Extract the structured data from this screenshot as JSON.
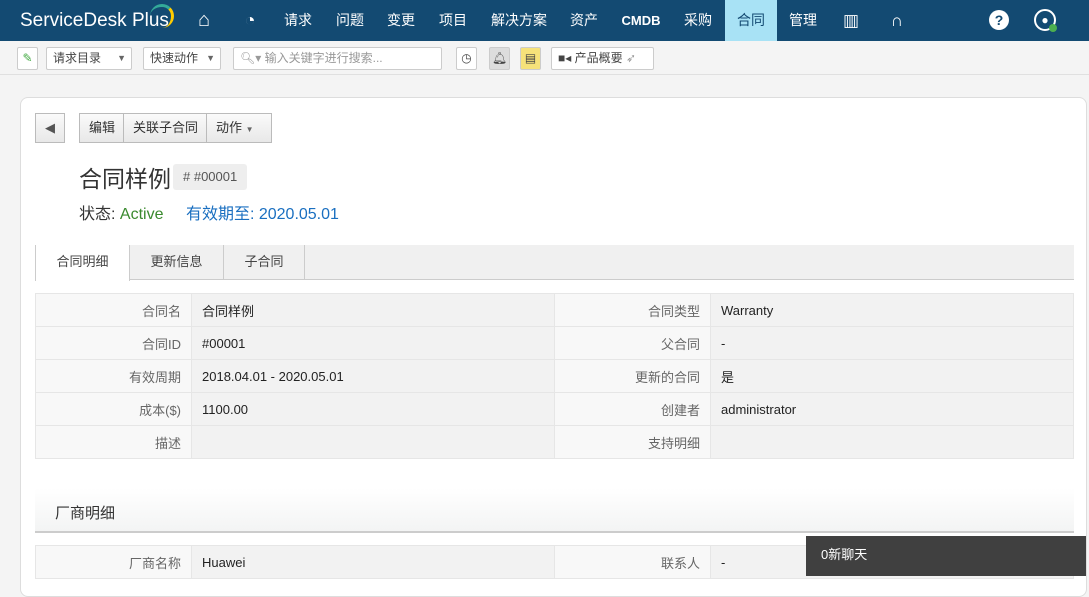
{
  "nav": {
    "logo_main": "ServiceDesk",
    "logo_plus": "Plus",
    "items": [
      "请求",
      "问题",
      "变更",
      "项目",
      "解决方案",
      "资产",
      "CMDB",
      "采购",
      "合同",
      "管理"
    ],
    "active": "合同"
  },
  "toolbar": {
    "request_catalog": "请求目录",
    "quick_actions": "快速动作",
    "search_placeholder": "输入关键字进行搜索...",
    "product_overview": "产品概要"
  },
  "actions": {
    "edit": "编辑",
    "link_child": "关联子合同",
    "actions": "动作"
  },
  "contract": {
    "title": "合同样例",
    "id_badge": "# #00001",
    "status_label": "状态:",
    "status": "Active",
    "expiry_label": "有效期至:",
    "expiry": "2020.05.01",
    "status_color": "#3a8a2e",
    "expiry_color": "#1a6fc0"
  },
  "tabs": [
    "合同明细",
    "更新信息",
    "子合同"
  ],
  "details": [
    [
      "合同名",
      "合同样例",
      "合同类型",
      "Warranty"
    ],
    [
      "合同ID",
      "#00001",
      "父合同",
      "-"
    ],
    [
      "有效周期",
      "2018.04.01 - 2020.05.01",
      "更新的合同",
      "是"
    ],
    [
      "成本($)",
      "1100.00",
      "创建者",
      "administrator"
    ],
    [
      "描述",
      "",
      "支持明细",
      ""
    ]
  ],
  "vendor": {
    "title": "厂商明细",
    "rows": [
      [
        "厂商名称",
        "Huawei",
        "联系人",
        "-"
      ]
    ]
  },
  "chat": {
    "label": "0新聊天"
  }
}
